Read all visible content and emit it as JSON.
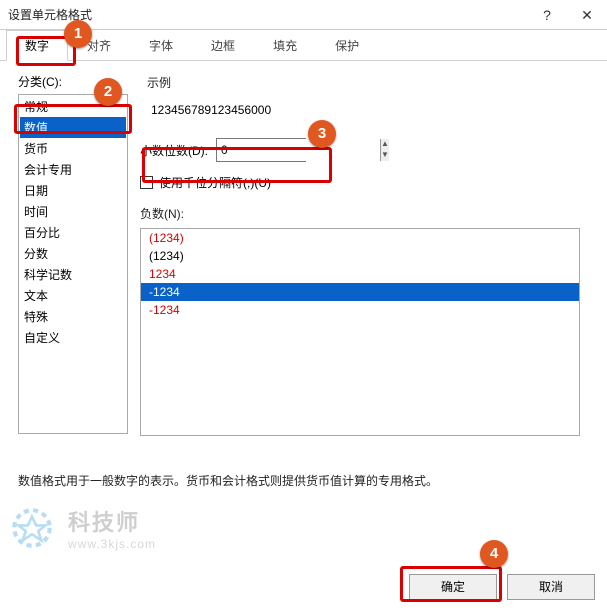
{
  "title": "设置单元格格式",
  "help_icon": "?",
  "close_icon": "✕",
  "tabs": {
    "number": "数字",
    "align": "对齐",
    "font": "字体",
    "border": "边框",
    "fill": "填充",
    "protect": "保护"
  },
  "left_label": "分类(C):",
  "categories": {
    "items": [
      "常规",
      "数值",
      "货币",
      "会计专用",
      "日期",
      "时间",
      "百分比",
      "分数",
      "科学记数",
      "文本",
      "特殊",
      "自定义"
    ],
    "c0": "常规",
    "c1": "数值",
    "c2": "货币",
    "c3": "会计专用",
    "c4": "日期",
    "c5": "时间",
    "c6": "百分比",
    "c7": "分数",
    "c8": "科学记数",
    "c9": "文本",
    "c10": "特殊",
    "c11": "自定义"
  },
  "sample_label": "示例",
  "sample_value": "123456789123456000",
  "decimals_label": "小数位数(D):",
  "decimals_value": "0",
  "thousands_label": "使用千位分隔符(,)(U)",
  "neg_label": "负数(N):",
  "neg": {
    "n0": "(1234)",
    "n1": "(1234)",
    "n2": "1234",
    "n3": "-1234",
    "n4": "-1234"
  },
  "footnote": "数值格式用于一般数字的表示。货币和会计格式则提供货币值计算的专用格式。",
  "ok": "确定",
  "cancel": "取消",
  "annot": {
    "a1": "1",
    "a2": "2",
    "a3": "3",
    "a4": "4"
  },
  "watermark": {
    "title": "科技师",
    "url": "www.3kjs.com"
  }
}
